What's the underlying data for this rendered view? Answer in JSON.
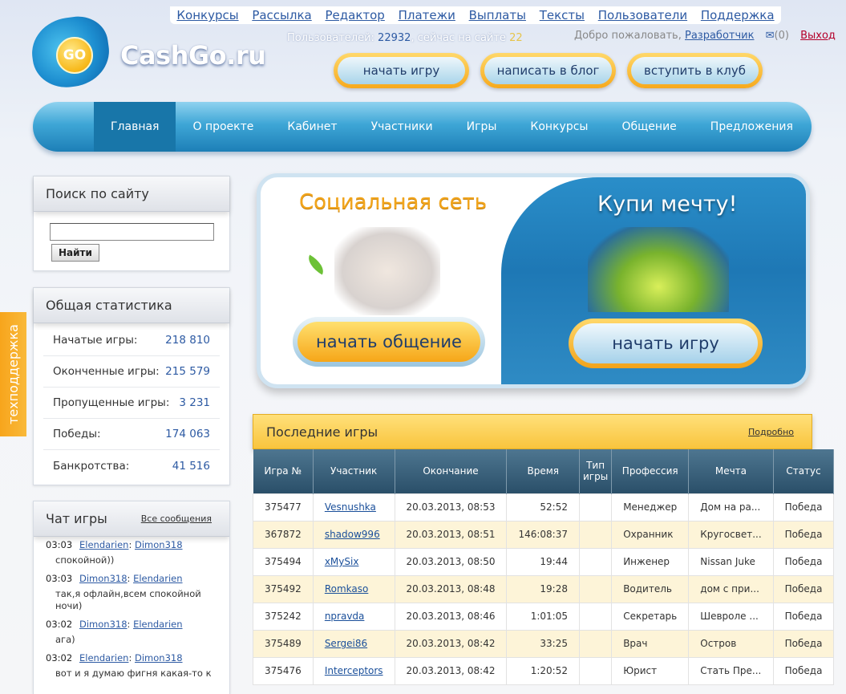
{
  "top_links": [
    "Конкурсы",
    "Рассылка",
    "Редактор",
    "Платежи",
    "Выплаты",
    "Тексты",
    "Пользователи",
    "Поддержка"
  ],
  "logo": {
    "mark": "GO",
    "text": "CashGo.ru"
  },
  "users": {
    "label": "Пользователей:",
    "total": "22932",
    "online_label": ", сейчас на сайте",
    "online": "22"
  },
  "welcome": {
    "text": "Добро пожаловать,",
    "user": "Разработчик",
    "mail_count": "(0)",
    "exit": "Выход"
  },
  "header_buttons": [
    "начать игру",
    "написать в блог",
    "вступить в клуб"
  ],
  "nav": [
    "Главная",
    "О проекте",
    "Кабинет",
    "Участники",
    "Игры",
    "Конкурсы",
    "Общение",
    "Предложения"
  ],
  "search": {
    "title": "Поиск по сайту",
    "value": "",
    "button": "Найти"
  },
  "stats": {
    "title": "Общая статистика",
    "rows": [
      {
        "label": "Начатые игры:",
        "value": "218 810"
      },
      {
        "label": "Оконченные игры:",
        "value": "215 579"
      },
      {
        "label": "Пропущенные игры:",
        "value": "3 231"
      },
      {
        "label": "Победы:",
        "value": "174 063"
      },
      {
        "label": "Банкротства:",
        "value": "41 516"
      }
    ]
  },
  "chat": {
    "title": "Чат игры",
    "all_link": "Все сообщения",
    "messages": [
      {
        "time": "03:03",
        "from": "Elendarien",
        "to": "Dimon318",
        "text": "спокойной))"
      },
      {
        "time": "03:03",
        "from": "Dimon318",
        "to": "Elendarien",
        "text": "так,я офлайн,всем спокойной ночи)"
      },
      {
        "time": "03:02",
        "from": "Dimon318",
        "to": "Elendarien",
        "text": "ага)"
      },
      {
        "time": "03:02",
        "from": "Elendarien",
        "to": "Dimon318",
        "text": "вот и я думаю фигня какая-то к"
      }
    ]
  },
  "tech_support": "техподдержка",
  "banner": {
    "left_title": "Социальная сеть",
    "left_button": "начать общение",
    "right_title": "Купи мечту!",
    "right_button": "начать игру"
  },
  "games": {
    "title": "Последние игры",
    "more": "Подробно",
    "headers": [
      "Игра №",
      "Участник",
      "Окончание",
      "Время",
      "Тип игры",
      "Профессия",
      "Мечта",
      "Статус"
    ],
    "rows": [
      [
        "375477",
        "Vesnushka",
        "20.03.2013, 08:53",
        "52:52",
        "",
        "Менеджер",
        "Дом на ра...",
        "Победа"
      ],
      [
        "367872",
        "shadow996",
        "20.03.2013, 08:51",
        "146:08:37",
        "",
        "Охранник",
        "Кругосвет...",
        "Победа"
      ],
      [
        "375494",
        "xMySix",
        "20.03.2013, 08:50",
        "19:44",
        "",
        "Инженер",
        "Nissan Juke",
        "Победа"
      ],
      [
        "375492",
        "Romkaso",
        "20.03.2013, 08:48",
        "19:28",
        "",
        "Водитель",
        "дом с при...",
        "Победа"
      ],
      [
        "375242",
        "npravda",
        "20.03.2013, 08:46",
        "1:01:05",
        "",
        "Секретарь",
        "Шевроле ...",
        "Победа"
      ],
      [
        "375489",
        "Sergei86",
        "20.03.2013, 08:42",
        "33:25",
        "",
        "Врач",
        "Остров",
        "Победа"
      ],
      [
        "375476",
        "Interceptors",
        "20.03.2013, 08:42",
        "1:20:52",
        "",
        "Юрист",
        "Стать Пре...",
        "Победа"
      ]
    ]
  },
  "colors": {
    "accent_blue": "#2d5aa3",
    "nav_blue": "#1d7fb7",
    "orange": "#f7a91c",
    "exit_red": "#b4002a"
  }
}
